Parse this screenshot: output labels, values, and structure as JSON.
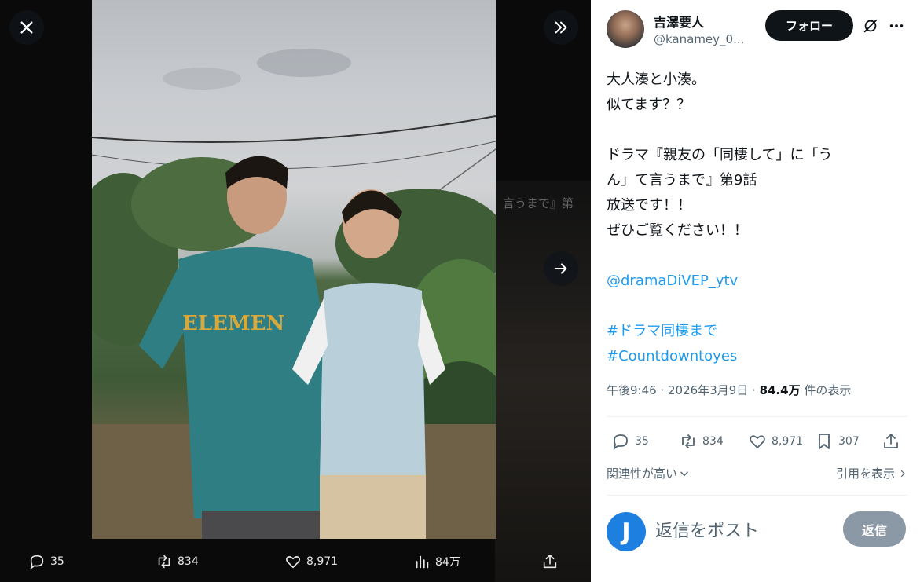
{
  "viewer": {
    "background_text": "言うまで』第",
    "actions": {
      "replies": "35",
      "reposts": "834",
      "likes": "8,971",
      "views": "84万"
    }
  },
  "post": {
    "author_name": "吉澤要人",
    "author_handle": "@kanamey_0...",
    "follow_label": "フォロー",
    "text_lines": [
      "大人湊と小湊。",
      "似てます？？",
      "",
      "ドラマ『親友の「同棲して」に「う",
      "ん」て言うまで』第9話",
      "放送です！！",
      "ぜひご覧ください！！"
    ],
    "mention": "@dramaDiVEP_ytv",
    "hashtags": [
      "#ドラマ同棲まで",
      "#Countdowntoyes"
    ],
    "timestamp": "午後9:46 · 2026年3月9日 · ",
    "views_count": "84.4万",
    "views_suffix": " 件の表示",
    "stats": {
      "replies": "35",
      "reposts": "834",
      "likes": "8,971",
      "bookmarks": "307"
    },
    "sort_label": "関連性が高い",
    "quotes_label": "引用を表示",
    "reply_placeholder": "返信をポスト",
    "reply_button": "返信",
    "my_avatar_letter": "J"
  },
  "colors": {
    "accent": "#1d9bf0",
    "follow_button_bg": "#0f1419",
    "reply_button_bg": "#8b98a5",
    "my_avatar_bg": "#1d7fe0"
  }
}
